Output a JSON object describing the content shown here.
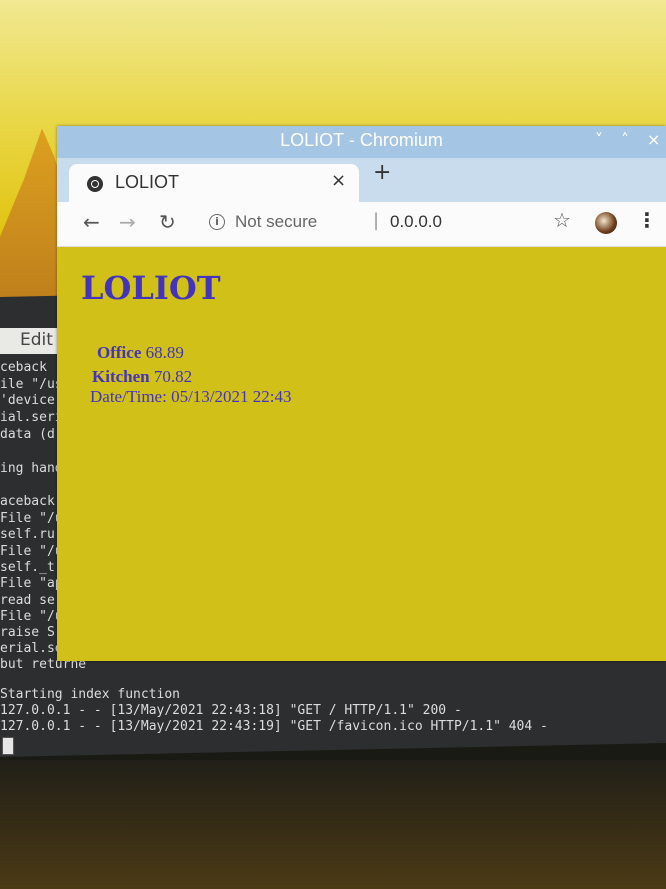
{
  "browser": {
    "window_title": "LOLIOT - Chromium",
    "tab_title": "LOLIOT",
    "new_tab_symbol": "+",
    "tab_close_symbol": "×",
    "security_label": "Not secure",
    "url": "0.0.0.0",
    "window_controls": [
      "˅",
      "˄",
      "×"
    ],
    "nav_icons": [
      "back-arrow-icon",
      "forward-arrow-icon",
      "reload-icon"
    ]
  },
  "page": {
    "heading": "LOLIOT",
    "readings": [
      {
        "label": "Office",
        "value": "68.89"
      },
      {
        "label": "Kitchen",
        "value": "70.82"
      }
    ],
    "datetime_label": "Date/Time:",
    "datetime_value": "05/13/2021 22:43"
  },
  "terminal": {
    "menu_label": "Edit",
    "lines": [
      "ceback (",
      "ile \"/us",
      " 'device",
      "ial.seri",
      " data (d",
      "",
      "ing hand",
      "",
      "aceback (",
      "File \"/us",
      "  self.ru",
      "File \"/us",
      "  self._t",
      "File \"app",
      "  read se",
      "File \"/us",
      "  raise S",
      "erial.seri",
      " but returne"
    ],
    "log_lines": [
      "Starting index function",
      "127.0.0.1 - - [13/May/2021 22:43:18] \"GET / HTTP/1.1\" 200 -",
      "127.0.0.1 - - [13/May/2021 22:43:19] \"GET /favicon.ico HTTP/1.1\" 404 -"
    ]
  },
  "colors": {
    "page_background": "#d1c018",
    "heading_color": "#4433bb",
    "titlebar": "#a5c5e4"
  }
}
